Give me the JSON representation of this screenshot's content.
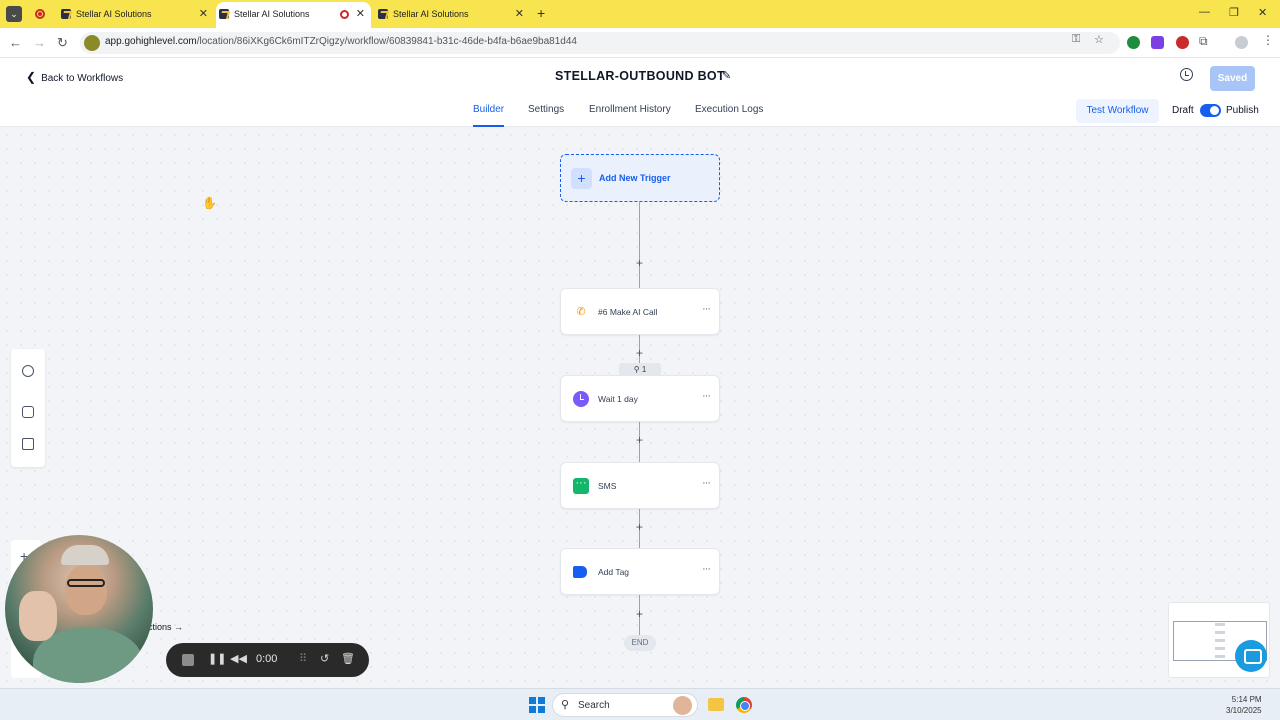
{
  "browser": {
    "tabs": [
      {
        "title": "Stellar AI Solutions"
      },
      {
        "title": "Stellar AI Solutions"
      },
      {
        "title": "Stellar AI Solutions"
      }
    ],
    "url_host": "app.gohighlevel.com",
    "url_path": "/location/86iXKg6Ck6mITZrQigzy/workflow/60839841-b31c-46de-b4fa-b6ae9ba81d44"
  },
  "header": {
    "back_label": "Back to Workflows",
    "workflow_name": "STELLAR-OUTBOUND BOT",
    "saved_label": "Saved"
  },
  "subnav": {
    "tabs": [
      {
        "label": "Builder",
        "active": true
      },
      {
        "label": "Settings",
        "active": false
      },
      {
        "label": "Enrollment History",
        "active": false
      },
      {
        "label": "Execution Logs",
        "active": false
      }
    ],
    "test_label": "Test Workflow",
    "draft_label": "Draft",
    "publish_label": "Publish",
    "published": true
  },
  "builder": {
    "trigger_label": "Add New Trigger",
    "nodes": [
      {
        "label": "#6 Make AI Call",
        "icon": "phone-icon"
      },
      {
        "label": "Wait 1 day",
        "icon": "clock-icon"
      },
      {
        "label": "SMS",
        "icon": "sms-icon"
      },
      {
        "label": "Add Tag",
        "icon": "tag-icon"
      }
    ],
    "enrolled_count": "1",
    "end_label": "END",
    "actions_label": "ctions"
  },
  "recorder": {
    "time": "0:00"
  },
  "taskbar": {
    "search_label": "Search",
    "time": "5:14 PM",
    "date": "3/10/2025"
  },
  "colors": {
    "accent": "#155eef",
    "chrome_tabbar": "#f7e44e"
  }
}
